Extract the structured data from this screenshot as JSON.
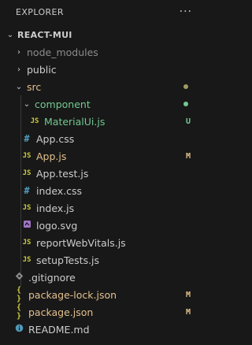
{
  "header": {
    "title": "EXPLORER",
    "more": "···"
  },
  "root": {
    "label": "REACT-MUI"
  },
  "tree": {
    "node_modules": "node_modules",
    "public": "public",
    "src": "src",
    "component": "component",
    "materialui": "MaterialUi.js",
    "materialui_status": "U",
    "app_css": "App.css",
    "app_js": "App.js",
    "app_js_status": "M",
    "app_test": "App.test.js",
    "index_css": "index.css",
    "index_js": "index.js",
    "logo": "logo.svg",
    "report": "reportWebVitals.js",
    "setup": "setupTests.js",
    "gitignore": ".gitignore",
    "pkglock": "package-lock.json",
    "pkglock_status": "M",
    "pkg": "package.json",
    "pkg_status": "M",
    "readme": "README.md"
  },
  "icons": {
    "js": "JS",
    "css": "#",
    "json": "{ }"
  },
  "colors": {
    "modified": "#e2c08d",
    "untracked": "#73c991",
    "folder_dot": "#a09b60",
    "ignored": "#8c8c8c",
    "js_icon": "#cbcb41",
    "css_icon": "#519aba",
    "svg_icon": "#a074c4",
    "readme_icon": "#519aba",
    "git_icon": "#8c8c8c"
  }
}
